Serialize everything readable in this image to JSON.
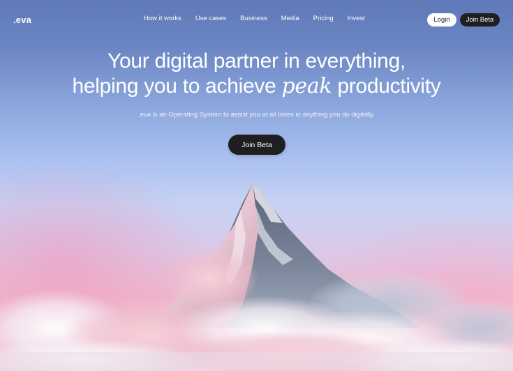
{
  "brand": {
    "logo": ".eva"
  },
  "nav": {
    "items": [
      {
        "label": "How it works"
      },
      {
        "label": "Use cases"
      },
      {
        "label": "Business"
      },
      {
        "label": "Media"
      },
      {
        "label": "Pricing"
      },
      {
        "label": "Invest"
      }
    ],
    "login_label": "Login",
    "beta_label": "Join Beta"
  },
  "hero": {
    "headline_line1": "Your digital partner in everything,",
    "headline_line2_before": "helping you to achieve ",
    "headline_line2_emphasis": "peak",
    "headline_line2_after": " productivity",
    "subtitle": ".eva is an Operating System to assist you at all times in anything you do digitally.",
    "cta_label": "Join Beta",
    "image": "snow-capped-mountain-peak-above-clouds"
  },
  "colors": {
    "sky_top": "#5f79b8",
    "sky_mid": "#a8bff0",
    "sky_bottom_pink": "#efb8d0",
    "button_dark": "#1f1f22",
    "button_light": "#ffffff"
  }
}
